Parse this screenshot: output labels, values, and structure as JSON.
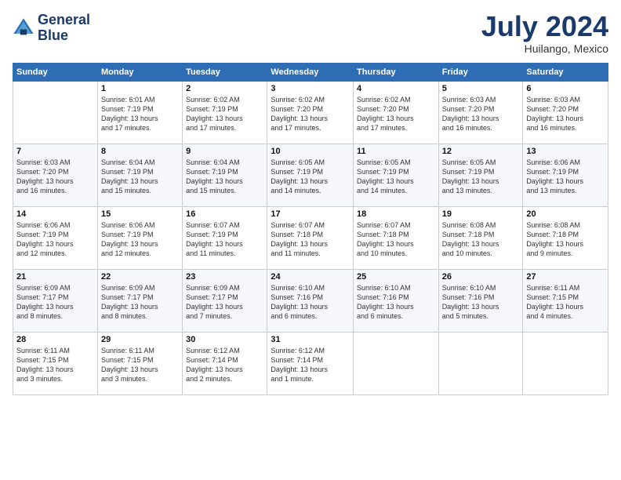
{
  "header": {
    "logo_line1": "General",
    "logo_line2": "Blue",
    "month": "July 2024",
    "location": "Huilango, Mexico"
  },
  "columns": [
    "Sunday",
    "Monday",
    "Tuesday",
    "Wednesday",
    "Thursday",
    "Friday",
    "Saturday"
  ],
  "weeks": [
    [
      {
        "day": "",
        "sunrise": "",
        "sunset": "",
        "daylight": ""
      },
      {
        "day": "1",
        "sunrise": "Sunrise: 6:01 AM",
        "sunset": "Sunset: 7:19 PM",
        "daylight": "Daylight: 13 hours and 17 minutes."
      },
      {
        "day": "2",
        "sunrise": "Sunrise: 6:02 AM",
        "sunset": "Sunset: 7:19 PM",
        "daylight": "Daylight: 13 hours and 17 minutes."
      },
      {
        "day": "3",
        "sunrise": "Sunrise: 6:02 AM",
        "sunset": "Sunset: 7:20 PM",
        "daylight": "Daylight: 13 hours and 17 minutes."
      },
      {
        "day": "4",
        "sunrise": "Sunrise: 6:02 AM",
        "sunset": "Sunset: 7:20 PM",
        "daylight": "Daylight: 13 hours and 17 minutes."
      },
      {
        "day": "5",
        "sunrise": "Sunrise: 6:03 AM",
        "sunset": "Sunset: 7:20 PM",
        "daylight": "Daylight: 13 hours and 16 minutes."
      },
      {
        "day": "6",
        "sunrise": "Sunrise: 6:03 AM",
        "sunset": "Sunset: 7:20 PM",
        "daylight": "Daylight: 13 hours and 16 minutes."
      }
    ],
    [
      {
        "day": "7",
        "sunrise": "Sunrise: 6:03 AM",
        "sunset": "Sunset: 7:20 PM",
        "daylight": "Daylight: 13 hours and 16 minutes."
      },
      {
        "day": "8",
        "sunrise": "Sunrise: 6:04 AM",
        "sunset": "Sunset: 7:19 PM",
        "daylight": "Daylight: 13 hours and 15 minutes."
      },
      {
        "day": "9",
        "sunrise": "Sunrise: 6:04 AM",
        "sunset": "Sunset: 7:19 PM",
        "daylight": "Daylight: 13 hours and 15 minutes."
      },
      {
        "day": "10",
        "sunrise": "Sunrise: 6:05 AM",
        "sunset": "Sunset: 7:19 PM",
        "daylight": "Daylight: 13 hours and 14 minutes."
      },
      {
        "day": "11",
        "sunrise": "Sunrise: 6:05 AM",
        "sunset": "Sunset: 7:19 PM",
        "daylight": "Daylight: 13 hours and 14 minutes."
      },
      {
        "day": "12",
        "sunrise": "Sunrise: 6:05 AM",
        "sunset": "Sunset: 7:19 PM",
        "daylight": "Daylight: 13 hours and 13 minutes."
      },
      {
        "day": "13",
        "sunrise": "Sunrise: 6:06 AM",
        "sunset": "Sunset: 7:19 PM",
        "daylight": "Daylight: 13 hours and 13 minutes."
      }
    ],
    [
      {
        "day": "14",
        "sunrise": "Sunrise: 6:06 AM",
        "sunset": "Sunset: 7:19 PM",
        "daylight": "Daylight: 13 hours and 12 minutes."
      },
      {
        "day": "15",
        "sunrise": "Sunrise: 6:06 AM",
        "sunset": "Sunset: 7:19 PM",
        "daylight": "Daylight: 13 hours and 12 minutes."
      },
      {
        "day": "16",
        "sunrise": "Sunrise: 6:07 AM",
        "sunset": "Sunset: 7:19 PM",
        "daylight": "Daylight: 13 hours and 11 minutes."
      },
      {
        "day": "17",
        "sunrise": "Sunrise: 6:07 AM",
        "sunset": "Sunset: 7:18 PM",
        "daylight": "Daylight: 13 hours and 11 minutes."
      },
      {
        "day": "18",
        "sunrise": "Sunrise: 6:07 AM",
        "sunset": "Sunset: 7:18 PM",
        "daylight": "Daylight: 13 hours and 10 minutes."
      },
      {
        "day": "19",
        "sunrise": "Sunrise: 6:08 AM",
        "sunset": "Sunset: 7:18 PM",
        "daylight": "Daylight: 13 hours and 10 minutes."
      },
      {
        "day": "20",
        "sunrise": "Sunrise: 6:08 AM",
        "sunset": "Sunset: 7:18 PM",
        "daylight": "Daylight: 13 hours and 9 minutes."
      }
    ],
    [
      {
        "day": "21",
        "sunrise": "Sunrise: 6:09 AM",
        "sunset": "Sunset: 7:17 PM",
        "daylight": "Daylight: 13 hours and 8 minutes."
      },
      {
        "day": "22",
        "sunrise": "Sunrise: 6:09 AM",
        "sunset": "Sunset: 7:17 PM",
        "daylight": "Daylight: 13 hours and 8 minutes."
      },
      {
        "day": "23",
        "sunrise": "Sunrise: 6:09 AM",
        "sunset": "Sunset: 7:17 PM",
        "daylight": "Daylight: 13 hours and 7 minutes."
      },
      {
        "day": "24",
        "sunrise": "Sunrise: 6:10 AM",
        "sunset": "Sunset: 7:16 PM",
        "daylight": "Daylight: 13 hours and 6 minutes."
      },
      {
        "day": "25",
        "sunrise": "Sunrise: 6:10 AM",
        "sunset": "Sunset: 7:16 PM",
        "daylight": "Daylight: 13 hours and 6 minutes."
      },
      {
        "day": "26",
        "sunrise": "Sunrise: 6:10 AM",
        "sunset": "Sunset: 7:16 PM",
        "daylight": "Daylight: 13 hours and 5 minutes."
      },
      {
        "day": "27",
        "sunrise": "Sunrise: 6:11 AM",
        "sunset": "Sunset: 7:15 PM",
        "daylight": "Daylight: 13 hours and 4 minutes."
      }
    ],
    [
      {
        "day": "28",
        "sunrise": "Sunrise: 6:11 AM",
        "sunset": "Sunset: 7:15 PM",
        "daylight": "Daylight: 13 hours and 3 minutes."
      },
      {
        "day": "29",
        "sunrise": "Sunrise: 6:11 AM",
        "sunset": "Sunset: 7:15 PM",
        "daylight": "Daylight: 13 hours and 3 minutes."
      },
      {
        "day": "30",
        "sunrise": "Sunrise: 6:12 AM",
        "sunset": "Sunset: 7:14 PM",
        "daylight": "Daylight: 13 hours and 2 minutes."
      },
      {
        "day": "31",
        "sunrise": "Sunrise: 6:12 AM",
        "sunset": "Sunset: 7:14 PM",
        "daylight": "Daylight: 13 hours and 1 minute."
      },
      {
        "day": "",
        "sunrise": "",
        "sunset": "",
        "daylight": ""
      },
      {
        "day": "",
        "sunrise": "",
        "sunset": "",
        "daylight": ""
      },
      {
        "day": "",
        "sunrise": "",
        "sunset": "",
        "daylight": ""
      }
    ]
  ]
}
